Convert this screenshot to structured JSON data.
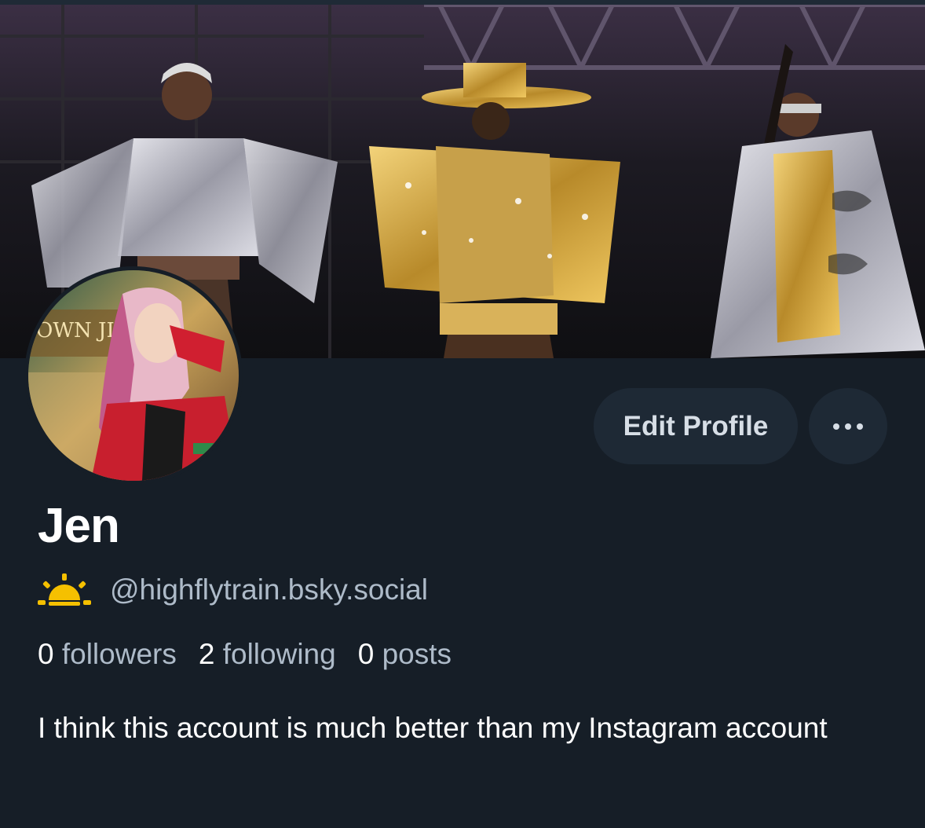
{
  "profile": {
    "display_name": "Jen",
    "handle": "@highflytrain.bsky.social",
    "bio": "I think this account is much better than my Instagram account",
    "status_icon": "sun-behind-cloud-icon",
    "avatar_icon": "avatar-photo",
    "banner_icon": "banner-photo"
  },
  "actions": {
    "edit_label": "Edit Profile",
    "more_icon": "more-options-icon"
  },
  "stats": {
    "followers_count": "0",
    "followers_label": "followers",
    "following_count": "2",
    "following_label": "following",
    "posts_count": "0",
    "posts_label": "posts"
  },
  "colors": {
    "background": "#161e27",
    "button_bg": "#1e2935",
    "muted_text": "#aebbc9",
    "primary_text": "#ffffff",
    "status_icon": "#f5c000"
  }
}
